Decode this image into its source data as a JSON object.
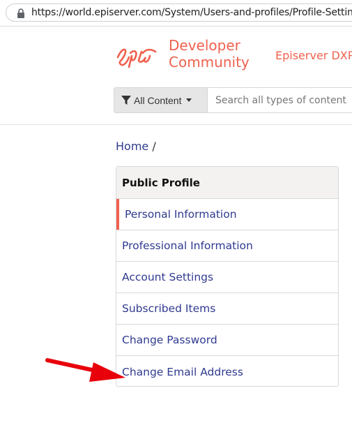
{
  "browser": {
    "url": "https://world.episerver.com/System/Users-and-profiles/Profile-Settings/"
  },
  "header": {
    "logo_line1": "Developer",
    "logo_line2": "Community",
    "product_link": "Episerver DXP"
  },
  "search": {
    "filter_label": "All Content",
    "placeholder": "Search all types of content"
  },
  "breadcrumb": {
    "home": "Home",
    "separator": "/"
  },
  "profile_menu": {
    "title": "Public Profile",
    "items": [
      {
        "label": "Personal Information",
        "active": true
      },
      {
        "label": "Professional Information",
        "active": false
      },
      {
        "label": "Account Settings",
        "active": false
      },
      {
        "label": "Subscribed Items",
        "active": false
      },
      {
        "label": "Change Password",
        "active": false
      },
      {
        "label": "Change Email Address",
        "active": false
      }
    ]
  },
  "colors": {
    "brand": "#f0614f",
    "link": "#2f3a8f",
    "annotation_arrow": "#e8000b"
  },
  "icons": {
    "lock": "lock-icon",
    "filter": "filter-icon",
    "caret": "caret-down-icon",
    "annotation": "red-arrow-annotation"
  }
}
